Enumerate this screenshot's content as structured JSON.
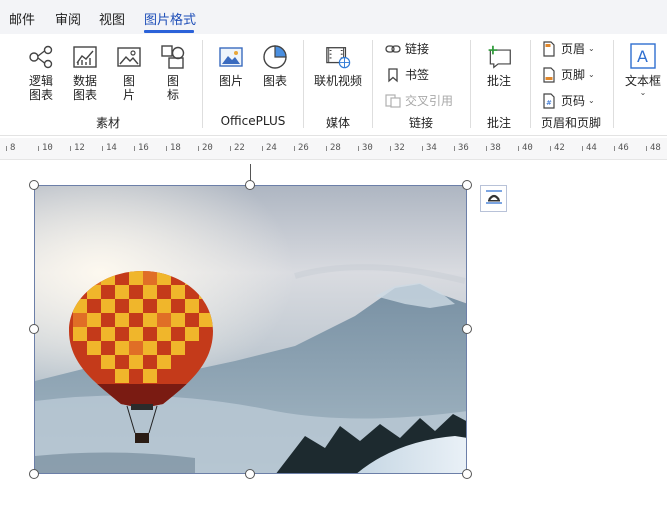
{
  "tabs": [
    {
      "label": "邮件"
    },
    {
      "label": "审阅"
    },
    {
      "label": "视图"
    },
    {
      "label": "图片格式"
    }
  ],
  "ribbon": {
    "material": {
      "logic_chart": "逻辑\n图表",
      "data_chart": "数据\n图表",
      "picture": "图\n片",
      "icon": "图\n标",
      "group": "素材"
    },
    "officeplus": {
      "picture": "图片",
      "chart": "图表",
      "group": "OfficePLUS"
    },
    "media": {
      "online_video": "联机视频",
      "group": "媒体"
    },
    "links": {
      "link": "链接",
      "bookmark": "书签",
      "cross_ref": "交叉引用",
      "group": "链接"
    },
    "comments": {
      "comment": "批注",
      "group": "批注"
    },
    "header_footer": {
      "header": "页眉",
      "footer": "页脚",
      "page_number": "页码",
      "group": "页眉和页脚"
    },
    "text": {
      "textbox": "文本框"
    }
  },
  "ruler": [
    "8",
    "10",
    "12",
    "14",
    "16",
    "18",
    "20",
    "22",
    "24",
    "26",
    "28",
    "30",
    "32",
    "34",
    "36",
    "38",
    "40",
    "42",
    "44",
    "46",
    "48"
  ],
  "colors": {
    "accent": "#2b62d9",
    "tab_active": "#1f4fb8",
    "tabbar_bg": "#f3f4f7"
  }
}
